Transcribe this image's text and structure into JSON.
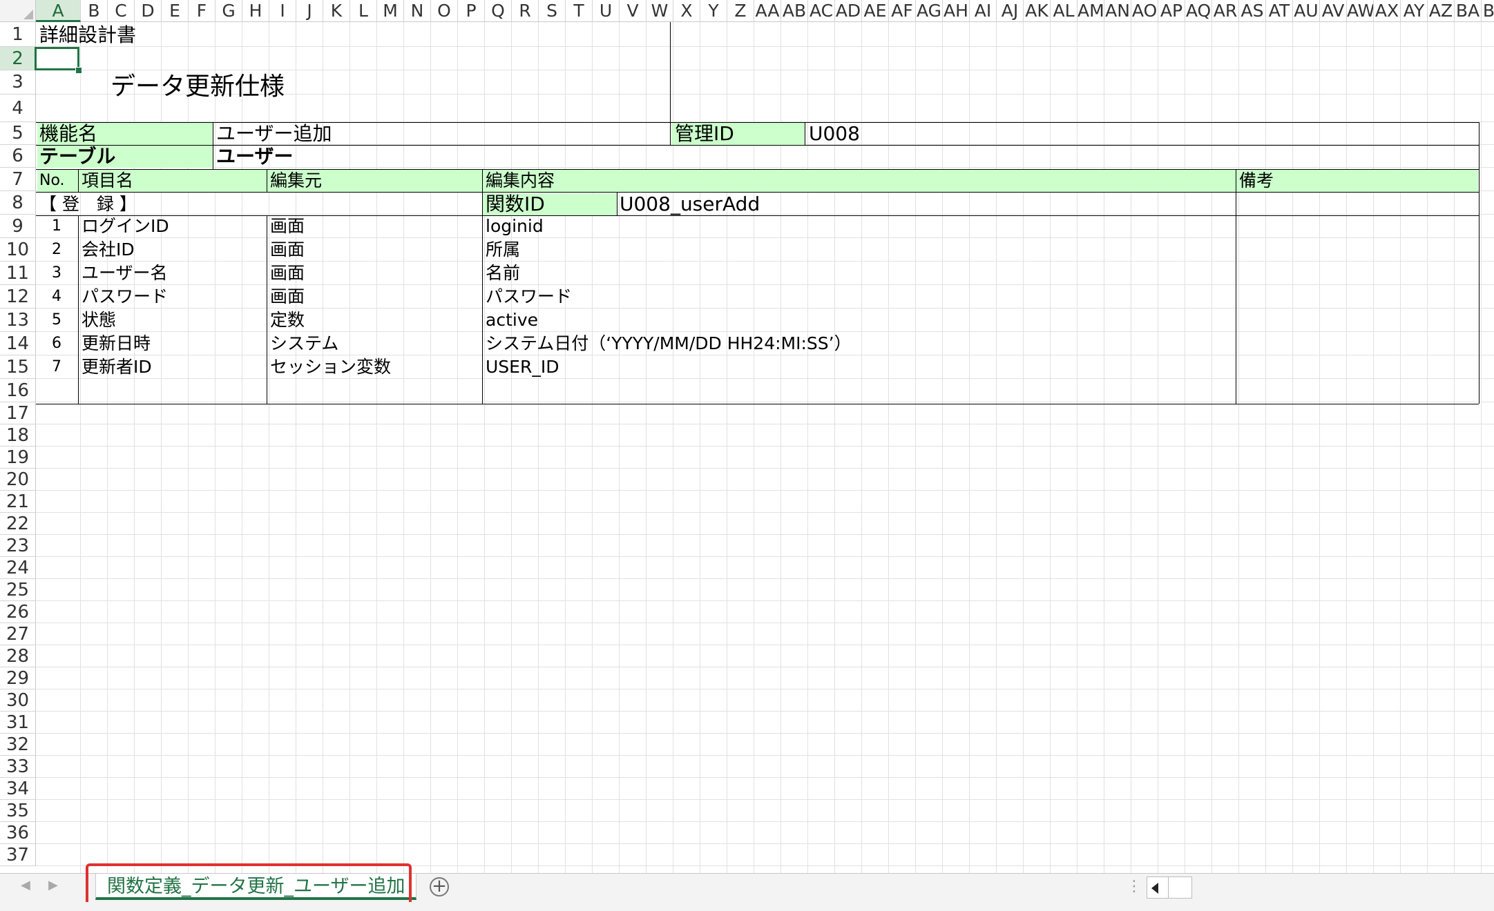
{
  "columns": [
    "A",
    "B",
    "C",
    "D",
    "E",
    "F",
    "G",
    "H",
    "I",
    "J",
    "K",
    "L",
    "M",
    "N",
    "O",
    "P",
    "Q",
    "R",
    "S",
    "T",
    "U",
    "V",
    "W",
    "X",
    "Y",
    "Z",
    "AA",
    "AB",
    "AC",
    "AD",
    "AE",
    "AF",
    "AG",
    "AH",
    "AI",
    "AJ",
    "AK",
    "AL",
    "AM",
    "AN",
    "AO",
    "AP",
    "AQ",
    "AR",
    "AS",
    "AT",
    "AU",
    "AV",
    "AW",
    "AX",
    "AY",
    "AZ",
    "BA",
    "BB"
  ],
  "rows": [
    "1",
    "2",
    "3",
    "4",
    "5",
    "6",
    "7",
    "8",
    "9",
    "10",
    "11",
    "12",
    "13",
    "14",
    "15",
    "16",
    "17",
    "18",
    "19",
    "20",
    "21",
    "22",
    "23",
    "24",
    "25",
    "26",
    "27",
    "28",
    "29",
    "30",
    "31",
    "32",
    "33",
    "34",
    "35",
    "36",
    "37"
  ],
  "selected_cell": {
    "column": "A",
    "row": "2"
  },
  "doc": {
    "header": "詳細設計書",
    "title": "データ更新仕様",
    "function_label": "機能名",
    "function_value": "ユーザー追加",
    "manage_id_label": "管理ID",
    "manage_id_value": "U008",
    "table_label": "テーブル",
    "table_value": "ユーザー",
    "col_no": "No.",
    "col_item": "項目名",
    "col_source": "編集元",
    "col_content": "編集内容",
    "col_note": "備考",
    "section_label": "【 登　録 】",
    "func_id_label": "関数ID",
    "func_id_value": "U008_userAdd"
  },
  "items": [
    {
      "no": "1",
      "name": "ログインID",
      "source": "画面",
      "content": "loginid"
    },
    {
      "no": "2",
      "name": "会社ID",
      "source": "画面",
      "content": "所属"
    },
    {
      "no": "3",
      "name": "ユーザー名",
      "source": "画面",
      "content": "名前"
    },
    {
      "no": "4",
      "name": "パスワード",
      "source": "画面",
      "content": "パスワード"
    },
    {
      "no": "5",
      "name": "状態",
      "source": "定数",
      "content": "active"
    },
    {
      "no": "6",
      "name": "更新日時",
      "source": "システム",
      "content": "システム日付（‘YYYY/MM/DD HH24:MI:SS’）"
    },
    {
      "no": "7",
      "name": "更新者ID",
      "source": "セッション変数",
      "content": "USER_ID"
    }
  ],
  "sheet_tab": {
    "label": "関数定義_データ更新_ユーザー追加",
    "color": "#217346"
  },
  "colors": {
    "header_fill": "#ccffcc",
    "grid_line": "#e1e1e1",
    "selection": "#217346",
    "annotation": "#e03030"
  },
  "icons": {
    "add_sheet": "plus-circle-icon",
    "scroll_left": "arrow-left-icon",
    "prev_sheet": "chevron-left-icon",
    "next_sheet": "chevron-right-icon"
  }
}
